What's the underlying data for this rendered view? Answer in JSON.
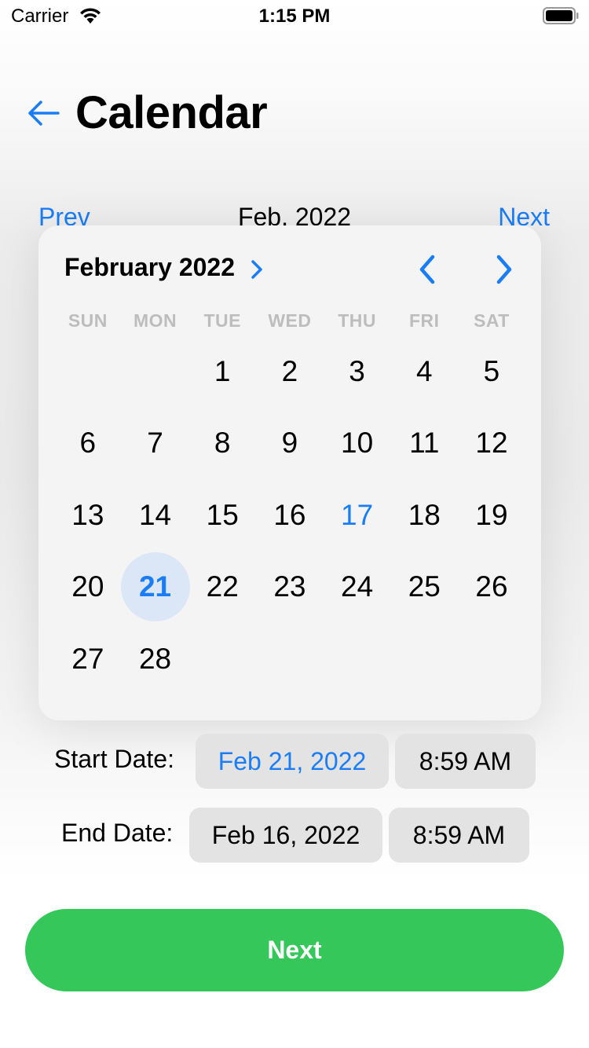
{
  "status_bar": {
    "carrier": "Carrier",
    "time": "1:15 PM",
    "icons": [
      "wifi-icon",
      "battery-icon"
    ]
  },
  "header": {
    "back_icon": "arrow-left-icon",
    "title": "Calendar"
  },
  "month_nav": {
    "prev_label": "Prev",
    "month_label": "Feb, 2022",
    "next_label": "Next"
  },
  "date_picker": {
    "month_year": "February 2022",
    "header_chevron_icon": "chevron-right-icon",
    "prev_icon": "chevron-left-icon",
    "next_icon": "chevron-right-icon",
    "weekdays": [
      "SUN",
      "MON",
      "TUE",
      "WED",
      "THU",
      "FRI",
      "SAT"
    ],
    "leading_blanks": 2,
    "days": [
      "1",
      "2",
      "3",
      "4",
      "5",
      "6",
      "7",
      "8",
      "9",
      "10",
      "11",
      "12",
      "13",
      "14",
      "15",
      "16",
      "17",
      "18",
      "19",
      "20",
      "21",
      "22",
      "23",
      "24",
      "25",
      "26",
      "27",
      "28"
    ],
    "today": "17",
    "selected": "21",
    "accent_color": "#1a7df5",
    "selection_bg": "#dbe7f6"
  },
  "start_date": {
    "label": "Start Date:",
    "date": "Feb 21, 2022",
    "time": "8:59 AM"
  },
  "end_date": {
    "label": "End Date:",
    "date": "Feb 16, 2022",
    "time": "8:59 AM"
  },
  "footer": {
    "next_button": "Next",
    "button_color": "#35c75a"
  }
}
